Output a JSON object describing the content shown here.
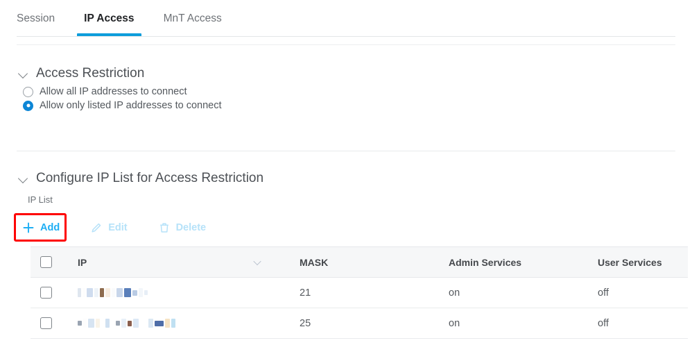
{
  "tabs": [
    {
      "label": "Session",
      "active": false
    },
    {
      "label": "IP Access",
      "active": true
    },
    {
      "label": "MnT Access",
      "active": false
    }
  ],
  "access_restriction": {
    "title": "Access Restriction",
    "options": [
      {
        "label": "Allow all IP addresses to connect",
        "selected": false
      },
      {
        "label": "Allow only listed IP addresses to connect",
        "selected": true
      }
    ]
  },
  "configure_section": {
    "title": "Configure IP List for Access Restriction",
    "list_label": "IP List"
  },
  "toolbar": {
    "add_label": "Add",
    "edit_label": "Edit",
    "delete_label": "Delete",
    "add_icon": "plus-icon",
    "edit_icon": "pencil-icon",
    "delete_icon": "trash-icon",
    "highlight_color": "#fe0000",
    "enabled_color": "#1eaef4",
    "disabled_color": "#b6e2f9"
  },
  "table": {
    "columns": [
      "IP",
      "MASK",
      "Admin Services",
      "User Services"
    ],
    "sort_icon": "chevron-down-icon",
    "rows": [
      {
        "ip": "",
        "ip_redacted": true,
        "mask": "21",
        "admin_services": "on",
        "user_services": "off"
      },
      {
        "ip": "",
        "ip_redacted": true,
        "mask": "25",
        "admin_services": "on",
        "user_services": "off"
      }
    ]
  },
  "colors": {
    "accent_blue": "#0d9ddb",
    "radio_blue": "#0d86d6",
    "header_bg": "#f6f7f8",
    "text_dark": "#1f2124",
    "text_muted": "#6e7277"
  }
}
